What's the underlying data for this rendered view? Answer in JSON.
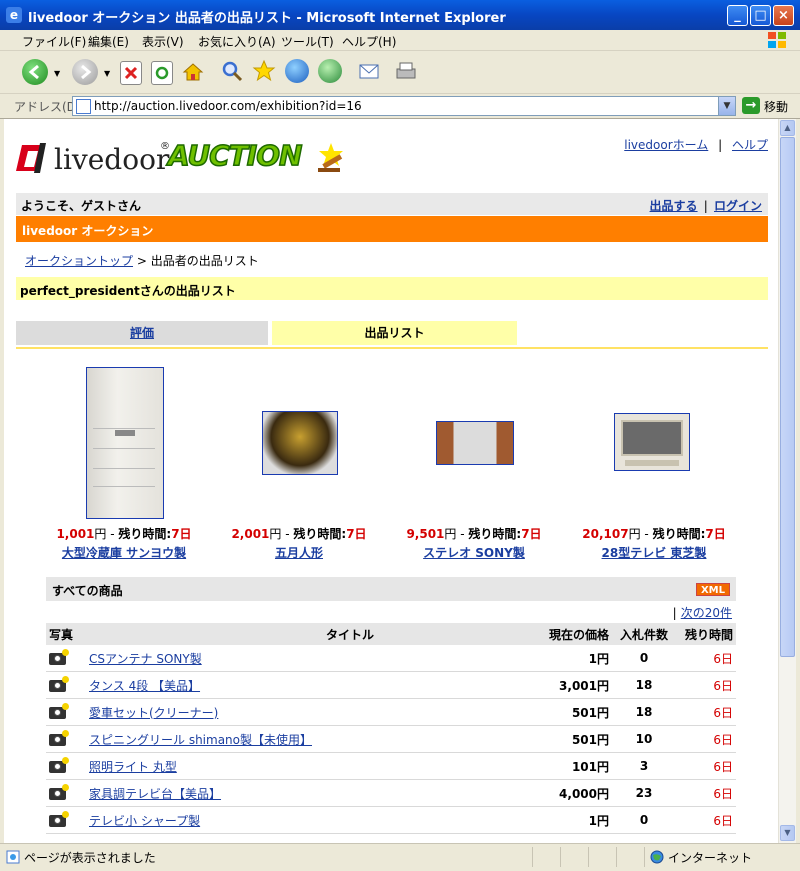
{
  "window": {
    "title": "livedoor オークション 出品者の出品リスト - Microsoft Internet Explorer"
  },
  "menu": [
    "ファイル(F)",
    "編集(E)",
    "表示(V)",
    "お気に入り(A)",
    "ツール(T)",
    "ヘルプ(H)"
  ],
  "address": {
    "label": "アドレス(D)",
    "url": "http://auction.livedoor.com/exhibition?id=16",
    "go_label": "移動"
  },
  "header": {
    "logo_text": "livedoor",
    "logo_mark": "®",
    "auction_text": "AUCTION",
    "home_link": "livedoorホーム",
    "sep": "|",
    "help_link": "ヘルプ"
  },
  "welcome": {
    "text": "ようこそ、ゲストさん",
    "sell_link": "出品する",
    "sep": "|",
    "login_link": "ログイン"
  },
  "section_title": "livedoor オークション",
  "breadcrumb": {
    "top_link": "オークショントップ",
    "arrow": " > ",
    "current": "出品者の出品リスト"
  },
  "list_title": "perfect_presidentさんの出品リスト",
  "tabs": {
    "rating": "評価",
    "listing": "出品リスト"
  },
  "featured": [
    {
      "price": "1,001",
      "yen": "円",
      "dash": " - ",
      "remain_label": "残り時間:",
      "remain": "7日",
      "name": "大型冷蔵庫 サンヨウ製"
    },
    {
      "price": "2,001",
      "yen": "円",
      "dash": " - ",
      "remain_label": "残り時間:",
      "remain": "7日",
      "name": "五月人形"
    },
    {
      "price": "9,501",
      "yen": "円",
      "dash": " - ",
      "remain_label": "残り時間:",
      "remain": "7日",
      "name": "ステレオ SONY製"
    },
    {
      "price": "20,107",
      "yen": "円",
      "dash": " - ",
      "remain_label": "残り時間:",
      "remain": "7日",
      "name": "28型テレビ 東芝製"
    }
  ],
  "all_items": {
    "title": "すべての商品",
    "xml_badge": "XML",
    "pager_sep": "|",
    "next_link": "次の20件",
    "columns": [
      "写真",
      "タイトル",
      "現在の価格",
      "入札件数",
      "残り時間"
    ],
    "rows": [
      {
        "title": "CSアンテナ SONY製",
        "price": "1円",
        "bids": "0",
        "remain": "6日"
      },
      {
        "title": "タンス 4段 【美品】",
        "price": "3,001円",
        "bids": "18",
        "remain": "6日"
      },
      {
        "title": "愛車セット(クリーナー)",
        "price": "501円",
        "bids": "18",
        "remain": "6日"
      },
      {
        "title": "スピニングリール shimano製【未使用】",
        "price": "501円",
        "bids": "10",
        "remain": "6日"
      },
      {
        "title": "照明ライト 丸型",
        "price": "101円",
        "bids": "3",
        "remain": "6日"
      },
      {
        "title": "家具調テレビ台【美品】",
        "price": "4,000円",
        "bids": "23",
        "remain": "6日"
      },
      {
        "title": "テレビ小 シャープ製",
        "price": "1円",
        "bids": "0",
        "remain": "6日"
      }
    ]
  },
  "status": {
    "text": "ページが表示されました",
    "zone": "インターネット"
  }
}
